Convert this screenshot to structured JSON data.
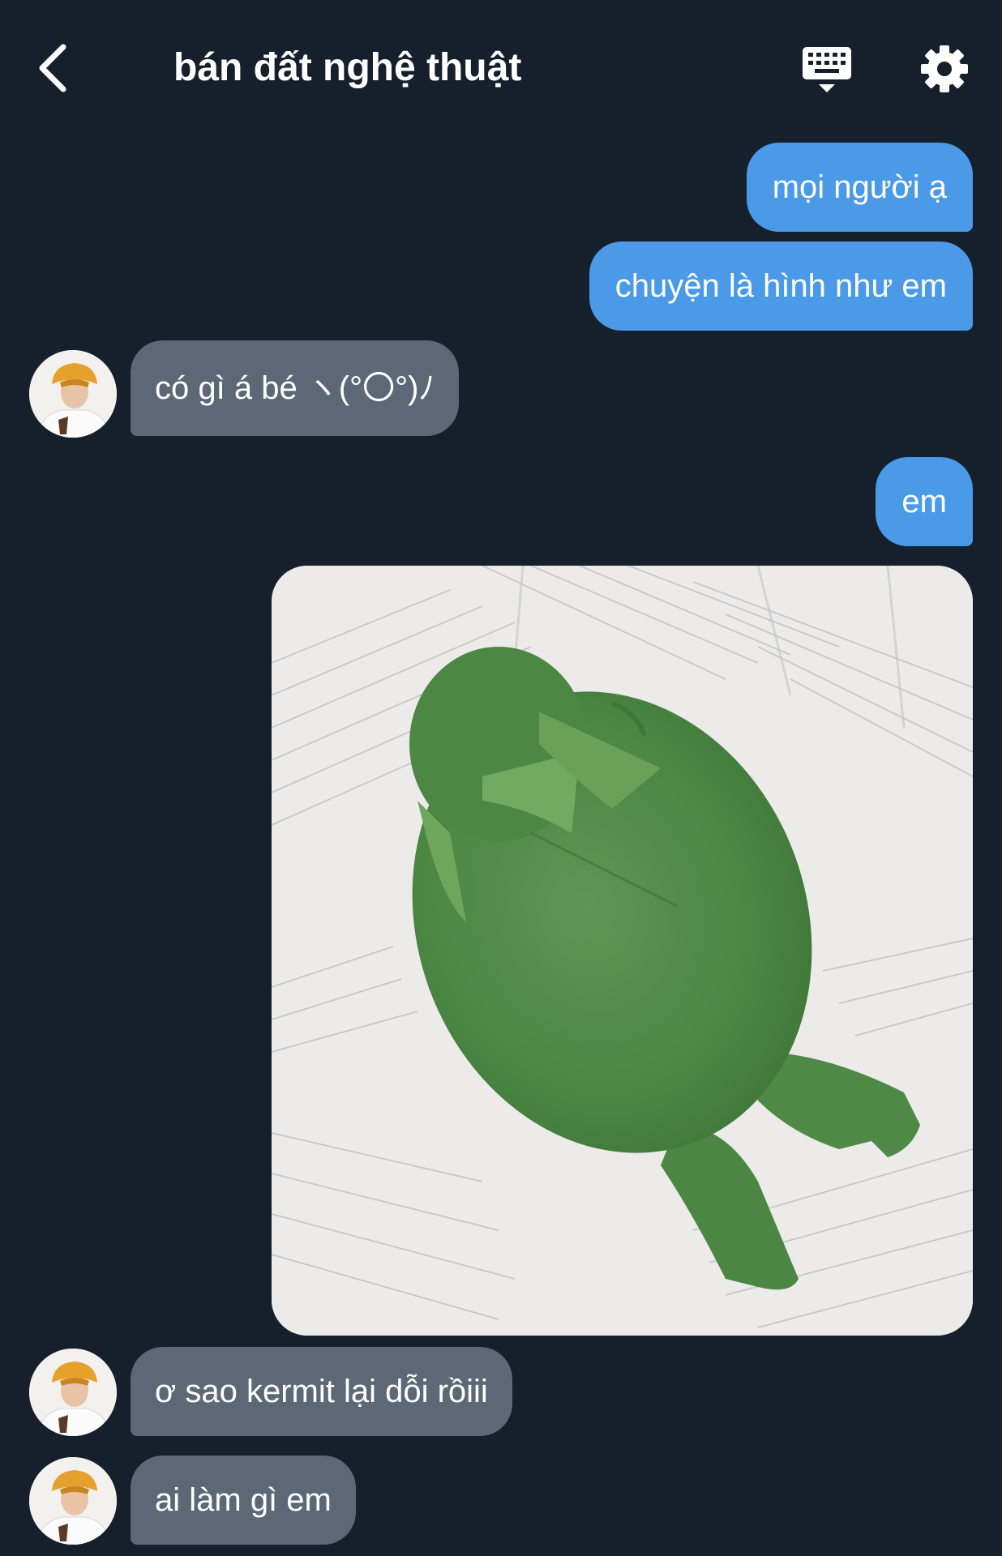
{
  "header": {
    "title": "bán đất nghệ thuật",
    "back_icon": "chevron-left-icon",
    "keyboard_icon": "keyboard-icon",
    "settings_icon": "gear-icon"
  },
  "colors": {
    "background": "#161f2c",
    "outgoing_bubble": "#4a9ae8",
    "incoming_bubble": "#5d6876"
  },
  "messages": [
    {
      "direction": "outgoing",
      "text": "mọi người ạ"
    },
    {
      "direction": "outgoing",
      "text": "chuyện là hình như em"
    },
    {
      "direction": "incoming",
      "text": "có gì á bé ヽ(°〇°)ﾉ"
    },
    {
      "direction": "outgoing",
      "text": "em"
    },
    {
      "direction": "outgoing",
      "type": "image",
      "image": "green-felt-kermit-plush-photo"
    },
    {
      "direction": "incoming",
      "text": "ơ sao kermit lại dỗi rồiii"
    },
    {
      "direction": "incoming",
      "text": "ai làm gì em"
    }
  ]
}
